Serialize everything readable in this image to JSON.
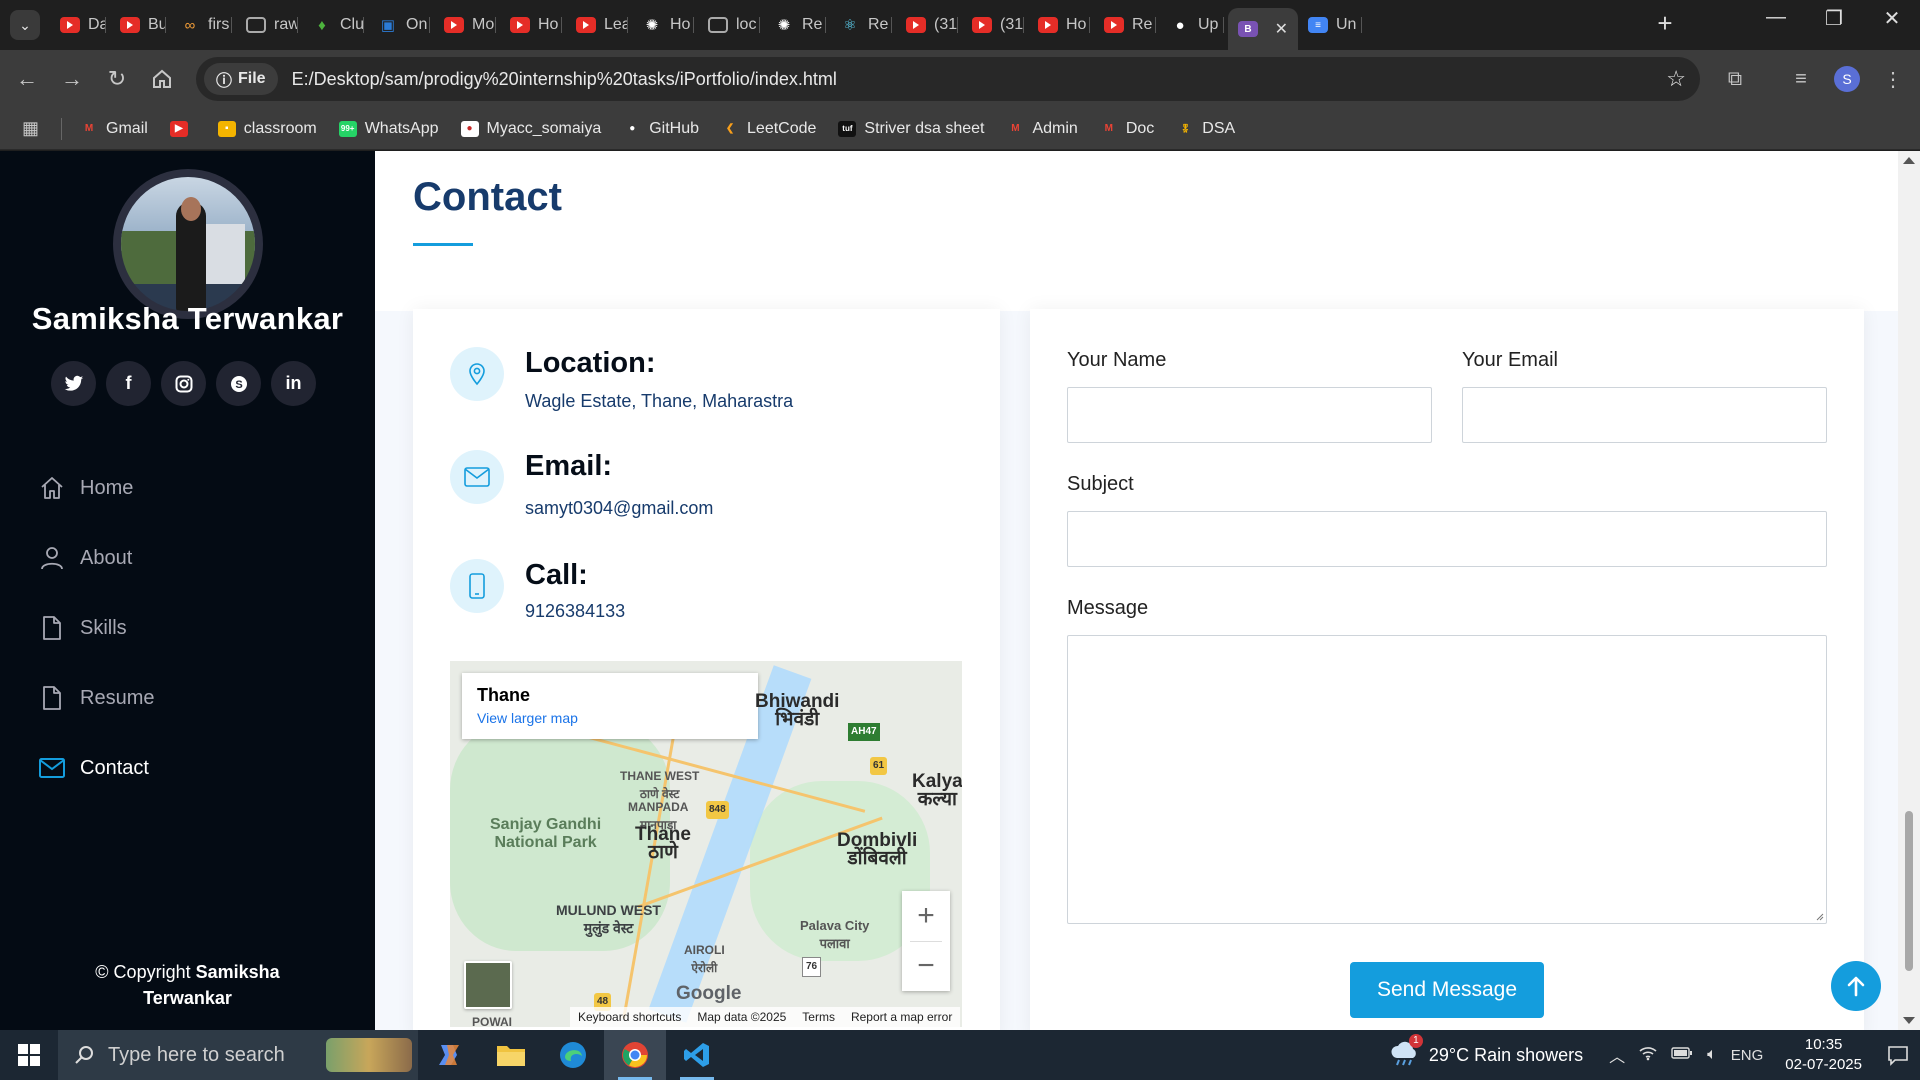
{
  "browser": {
    "tabs": [
      {
        "title": "Dat",
        "icon": "youtube-icon"
      },
      {
        "title": "Bui",
        "icon": "youtube-icon"
      },
      {
        "title": "firs",
        "icon": "infinity-icon"
      },
      {
        "title": "raw",
        "icon": "globe-icon"
      },
      {
        "title": "Clu",
        "icon": "leaf-icon"
      },
      {
        "title": "On",
        "icon": "doc-icon"
      },
      {
        "title": "Mo",
        "icon": "youtube-icon"
      },
      {
        "title": "Ho",
        "icon": "youtube-icon"
      },
      {
        "title": "Lea",
        "icon": "youtube-icon"
      },
      {
        "title": "Ho",
        "icon": "openai-icon"
      },
      {
        "title": "loc",
        "icon": "globe-icon"
      },
      {
        "title": "Re",
        "icon": "openai-icon"
      },
      {
        "title": "Re",
        "icon": "react-icon"
      },
      {
        "title": "(31",
        "icon": "youtube-icon"
      },
      {
        "title": "(31",
        "icon": "youtube-icon"
      },
      {
        "title": "Ho",
        "icon": "youtube-icon"
      },
      {
        "title": "Re",
        "icon": "youtube-icon"
      },
      {
        "title": "Up",
        "icon": "github-icon"
      },
      {
        "title": "B",
        "icon": "bootstrap-icon",
        "active": true
      },
      {
        "title": "Un",
        "icon": "docs-icon"
      }
    ],
    "address": {
      "scheme_label": "File",
      "url": "E:/Desktop/sam/prodigy%20internship%20tasks/iPortfolio/index.html"
    },
    "profile_initial": "S",
    "bookmarks": [
      {
        "label": "Gmail",
        "icon": "gmail-icon"
      },
      {
        "label": "",
        "icon": "youtube-icon"
      },
      {
        "label": "classroom",
        "icon": "classroom-icon"
      },
      {
        "label": "WhatsApp",
        "icon": "whatsapp-icon"
      },
      {
        "label": "Myacc_somaiya",
        "icon": "somaiya-icon"
      },
      {
        "label": "GitHub",
        "icon": "github-icon"
      },
      {
        "label": "LeetCode",
        "icon": "leetcode-icon"
      },
      {
        "label": "Striver dsa sheet",
        "icon": "tuf-icon"
      },
      {
        "label": "Admin",
        "icon": "gmail-icon"
      },
      {
        "label": "Doc",
        "icon": "gmail-icon"
      },
      {
        "label": "DSA",
        "icon": "medal-icon"
      }
    ]
  },
  "sidebar": {
    "name": "Samiksha Terwankar",
    "socials": [
      "twitter-icon",
      "facebook-icon",
      "instagram-icon",
      "skype-icon",
      "linkedin-icon"
    ],
    "nav": [
      {
        "label": "Home",
        "icon": "home-icon"
      },
      {
        "label": "About",
        "icon": "person-icon"
      },
      {
        "label": "Skills",
        "icon": "file-icon"
      },
      {
        "label": "Resume",
        "icon": "file-icon"
      },
      {
        "label": "Contact",
        "icon": "envelope-icon",
        "active": true
      }
    ],
    "copyright_prefix": "© Copyright",
    "copyright_name": "Samiksha",
    "copyright_name2": "Terwankar"
  },
  "contact": {
    "title": "Contact",
    "location_heading": "Location:",
    "location_value": "Wagle Estate, Thane, Maharastra",
    "email_heading": "Email:",
    "email_value": "samyt0304@gmail.com",
    "call_heading": "Call:",
    "call_value": "9126384133",
    "map": {
      "place": "Thane",
      "view_larger": "View larger map",
      "labels": {
        "bhiwandi": "Bhiwandi",
        "bhiwandi_local": "भिवंडी",
        "kalyan": "Kalya",
        "kalyan_local": "कल्या",
        "thane_west": "THANE WEST",
        "thane_west_local": "ठाणे वेस्ट",
        "manpada": "MANPADA",
        "manpada_local": "मानपाडा",
        "sgnp": "Sanjay Gandhi",
        "sgnp2": "National Park",
        "thane": "Thane",
        "thane_local": "ठाणे",
        "dombivli": "Dombivli",
        "dombivli_local": "डोंबिवली",
        "mulund": "MULUND WEST",
        "mulund_local": "मुलुंड वेस्ट",
        "airoli": "AIROLI",
        "airoli_local": "ऐरोली",
        "palava": "Palava City",
        "palava_local": "पलावा",
        "powai": "POWAI",
        "ah47": "AH47",
        "r61": "61",
        "r848": "848",
        "r76": "76",
        "r48": "48"
      },
      "google": "Google",
      "footer": {
        "shortcuts": "Keyboard shortcuts",
        "data": "Map data ©2025",
        "terms": "Terms",
        "report": "Report a map error"
      }
    },
    "form": {
      "name_label": "Your Name",
      "email_label": "Your Email",
      "subject_label": "Subject",
      "message_label": "Message",
      "name_value": "",
      "email_value": "",
      "subject_value": "",
      "message_value": "",
      "submit_label": "Send Message"
    }
  },
  "taskbar": {
    "search_placeholder": "Type here to search",
    "weather": "29°C  Rain showers",
    "weather_badge": "1",
    "language": "ENG",
    "time": "10:35",
    "date": "02-07-2025",
    "notification_count": "1"
  },
  "colors": {
    "accent": "#149ddd",
    "heading": "#173b6c",
    "sidebar_bg": "#040b14"
  }
}
